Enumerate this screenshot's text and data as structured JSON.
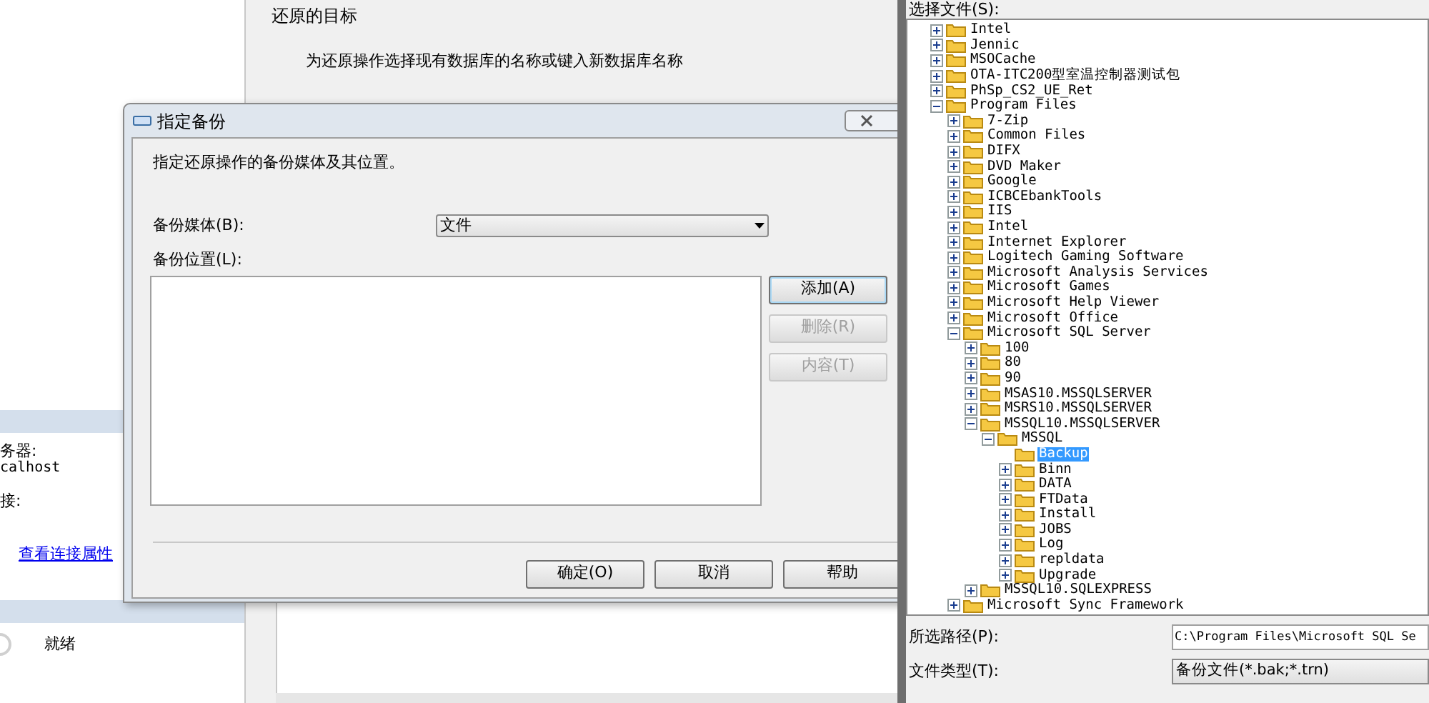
{
  "background_window": {
    "connection_panel": {
      "server_label": "务器:",
      "server_value": "calhost",
      "connection_label": "接:",
      "link": "查看连接属性",
      "status": "就绪"
    },
    "restore_target": {
      "heading": "还原的目标",
      "description": "为还原操作选择现有数据库的名称或键入新数据库名称"
    }
  },
  "dialog": {
    "title": "指定备份",
    "instruction": "指定还原操作的备份媒体及其位置。",
    "media_label": "备份媒体(B):",
    "media_value": "文件",
    "location_label": "备份位置(L):",
    "side_buttons": [
      {
        "label": "添加(A)",
        "disabled": false,
        "focused": true
      },
      {
        "label": "删除(R)",
        "disabled": true,
        "focused": false
      },
      {
        "label": "内容(T)",
        "disabled": true,
        "focused": false
      }
    ],
    "footer_buttons": [
      {
        "label": "确定(O)",
        "disabled": false
      },
      {
        "label": "取消",
        "disabled": false
      },
      {
        "label": "帮助",
        "disabled": false
      }
    ]
  },
  "file_window": {
    "tree_label": "选择文件(S):",
    "tree": [
      {
        "label": "Intel",
        "expandable": true,
        "expanded": false,
        "selected": false
      },
      {
        "label": "Jennic",
        "expandable": true,
        "expanded": false,
        "selected": false
      },
      {
        "label": "MSOCache",
        "expandable": true,
        "expanded": false,
        "selected": false
      },
      {
        "label": "OTA-ITC200型室温控制器测试包",
        "expandable": true,
        "expanded": false,
        "selected": false
      },
      {
        "label": "PhSp_CS2_UE_Ret",
        "expandable": true,
        "expanded": false,
        "selected": false
      },
      {
        "label": "Program Files",
        "expandable": true,
        "expanded": true,
        "selected": false,
        "children": [
          {
            "label": "7-Zip",
            "expandable": true,
            "expanded": false,
            "selected": false
          },
          {
            "label": "Common Files",
            "expandable": true,
            "expanded": false,
            "selected": false
          },
          {
            "label": "DIFX",
            "expandable": true,
            "expanded": false,
            "selected": false
          },
          {
            "label": "DVD Maker",
            "expandable": true,
            "expanded": false,
            "selected": false
          },
          {
            "label": "Google",
            "expandable": true,
            "expanded": false,
            "selected": false
          },
          {
            "label": "ICBCEbankTools",
            "expandable": true,
            "expanded": false,
            "selected": false
          },
          {
            "label": "IIS",
            "expandable": true,
            "expanded": false,
            "selected": false
          },
          {
            "label": "Intel",
            "expandable": true,
            "expanded": false,
            "selected": false
          },
          {
            "label": "Internet Explorer",
            "expandable": true,
            "expanded": false,
            "selected": false
          },
          {
            "label": "Logitech Gaming Software",
            "expandable": true,
            "expanded": false,
            "selected": false
          },
          {
            "label": "Microsoft Analysis Services",
            "expandable": true,
            "expanded": false,
            "selected": false
          },
          {
            "label": "Microsoft Games",
            "expandable": true,
            "expanded": false,
            "selected": false
          },
          {
            "label": "Microsoft Help Viewer",
            "expandable": true,
            "expanded": false,
            "selected": false
          },
          {
            "label": "Microsoft Office",
            "expandable": true,
            "expanded": false,
            "selected": false
          },
          {
            "label": "Microsoft SQL Server",
            "expandable": true,
            "expanded": true,
            "selected": false,
            "children": [
              {
                "label": "100",
                "expandable": true,
                "expanded": false,
                "selected": false
              },
              {
                "label": "80",
                "expandable": true,
                "expanded": false,
                "selected": false
              },
              {
                "label": "90",
                "expandable": true,
                "expanded": false,
                "selected": false
              },
              {
                "label": "MSAS10.MSSQLSERVER",
                "expandable": true,
                "expanded": false,
                "selected": false
              },
              {
                "label": "MSRS10.MSSQLSERVER",
                "expandable": true,
                "expanded": false,
                "selected": false
              },
              {
                "label": "MSSQL10.MSSQLSERVER",
                "expandable": true,
                "expanded": true,
                "selected": false,
                "children": [
                  {
                    "label": "MSSQL",
                    "expandable": true,
                    "expanded": true,
                    "selected": false,
                    "children": [
                      {
                        "label": "Backup",
                        "expandable": false,
                        "selected": true
                      },
                      {
                        "label": "Binn",
                        "expandable": true,
                        "expanded": false,
                        "selected": false
                      },
                      {
                        "label": "DATA",
                        "expandable": true,
                        "expanded": false,
                        "selected": false
                      },
                      {
                        "label": "FTData",
                        "expandable": true,
                        "expanded": false,
                        "selected": false
                      },
                      {
                        "label": "Install",
                        "expandable": true,
                        "expanded": false,
                        "selected": false
                      },
                      {
                        "label": "JOBS",
                        "expandable": true,
                        "expanded": false,
                        "selected": false
                      },
                      {
                        "label": "Log",
                        "expandable": true,
                        "expanded": false,
                        "selected": false
                      },
                      {
                        "label": "repldata",
                        "expandable": true,
                        "expanded": false,
                        "selected": false
                      },
                      {
                        "label": "Upgrade",
                        "expandable": true,
                        "expanded": false,
                        "selected": false
                      }
                    ]
                  }
                ]
              },
              {
                "label": "MSSQL10.SQLEXPRESS",
                "expandable": true,
                "expanded": false,
                "selected": false
              }
            ]
          },
          {
            "label": "Microsoft Sync Framework",
            "expandable": true,
            "expanded": false,
            "selected": false
          }
        ]
      }
    ],
    "path_label": "所选路径(P):",
    "path_value": "C:\\Program Files\\Microsoft SQL Se",
    "type_label": "文件类型(T):",
    "type_value": "备份文件(*.bak;*.trn)"
  }
}
